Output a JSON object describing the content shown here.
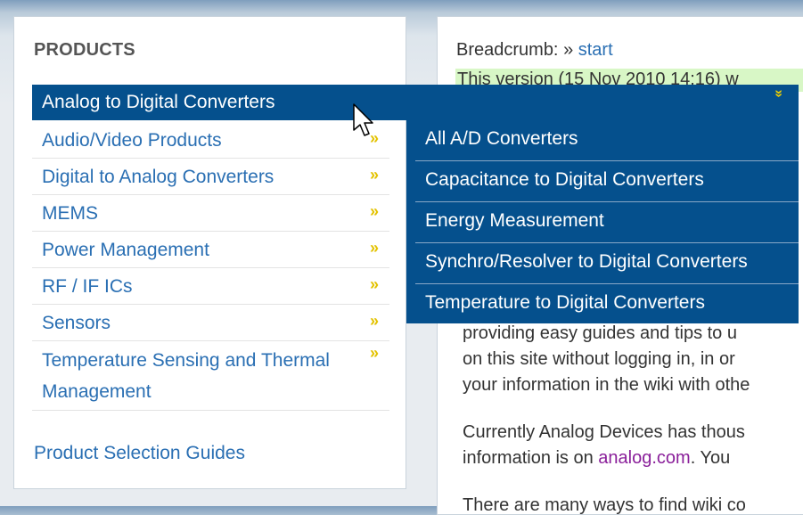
{
  "products": {
    "heading": "PRODUCTS",
    "menu": [
      {
        "label": "Analog to Digital Converters",
        "active": true
      },
      {
        "label": "Audio/Video Products"
      },
      {
        "label": "Digital to Analog Converters"
      },
      {
        "label": "MEMS"
      },
      {
        "label": "Power Management"
      },
      {
        "label": "RF / IF ICs"
      },
      {
        "label": "Sensors"
      },
      {
        "label_line1": "Temperature Sensing and Thermal",
        "label_line2": "Management"
      }
    ],
    "guides_link": "Product Selection Guides",
    "chevron_glyph": "»",
    "chevron_down_glyph": "»"
  },
  "flyout": {
    "items": [
      "All A/D Converters",
      "Capacitance to Digital Converters",
      "Energy Measurement",
      "Synchro/Resolver to Digital Converters",
      "Temperature to Digital Converters"
    ]
  },
  "content": {
    "breadcrumb_label": "Breadcrumb: ",
    "breadcrumb_sep": "» ",
    "breadcrumb_link": "start",
    "version_text": "This version (15 Nov 2010 14:16) w",
    "para1": [
      "providing easy guides and tips to u",
      "on this site without logging in, in or",
      "your information in the wiki with othe"
    ],
    "para2_line1": "Currently Analog Devices has thous",
    "para2_line2_prefix": "information is on ",
    "para2_link": "analog.com",
    "para2_line2_suffix": ". You ",
    "para3": "There are many ways to find wiki co"
  },
  "colors": {
    "menu_active_bg": "#05508d",
    "link": "#2a6fb3",
    "chevron": "#e3c200",
    "version_bg": "#d8f7c6",
    "visited_link": "#8a1f9a"
  }
}
